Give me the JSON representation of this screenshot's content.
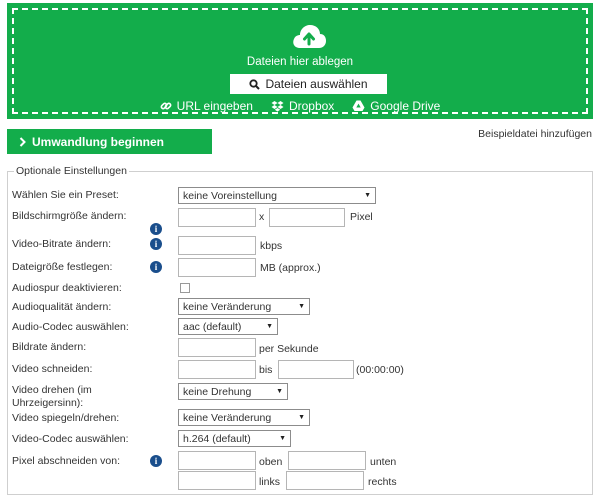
{
  "upload": {
    "drop_title": "Dateien hier ablegen",
    "select_files_label": "Dateien auswählen",
    "sources": [
      {
        "label": "URL eingeben",
        "icon": "link-icon"
      },
      {
        "label": "Dropbox",
        "icon": "dropbox-icon"
      },
      {
        "label": "Google Drive",
        "icon": "google-drive-icon"
      }
    ]
  },
  "actions": {
    "start_label": "Umwandlung beginnen",
    "sample_link": "Beispieldatei hinzufügen"
  },
  "options": {
    "legend": "Optionale Einstellungen",
    "preset": {
      "label": "Wählen Sie ein Preset:",
      "value": "keine Voreinstellung"
    },
    "screen_size": {
      "label": "Bildschirmgröße ändern:",
      "separator": "x",
      "unit": "Pixel"
    },
    "video_bitrate": {
      "label": "Video-Bitrate ändern:",
      "unit": "kbps"
    },
    "file_size": {
      "label": "Dateigröße festlegen:",
      "unit": "MB (approx.)"
    },
    "disable_audio": {
      "label": "Audiospur deaktivieren:"
    },
    "audio_quality": {
      "label": "Audioqualität ändern:",
      "value": "keine Veränderung"
    },
    "audio_codec": {
      "label": "Audio-Codec auswählen:",
      "value": "aac (default)"
    },
    "frame_rate": {
      "label": "Bildrate ändern:",
      "unit": "per Sekunde"
    },
    "cut_video": {
      "label": "Video schneiden:",
      "separator": "bis",
      "format_hint": "(00:00:00)"
    },
    "rotate": {
      "label": "Video drehen (im Uhrzeigersinn):",
      "value": "keine Drehung"
    },
    "mirror": {
      "label": "Video spiegeln/drehen:",
      "value": "keine Veränderung"
    },
    "video_codec": {
      "label": "Video-Codec auswählen:",
      "value": "h.264 (default)"
    },
    "crop": {
      "label": "Pixel abschneiden von:",
      "top": "oben",
      "bottom": "unten",
      "left": "links",
      "right": "rechts"
    }
  },
  "colors": {
    "accent": "#13ad4b",
    "info": "#1a4e8c"
  }
}
